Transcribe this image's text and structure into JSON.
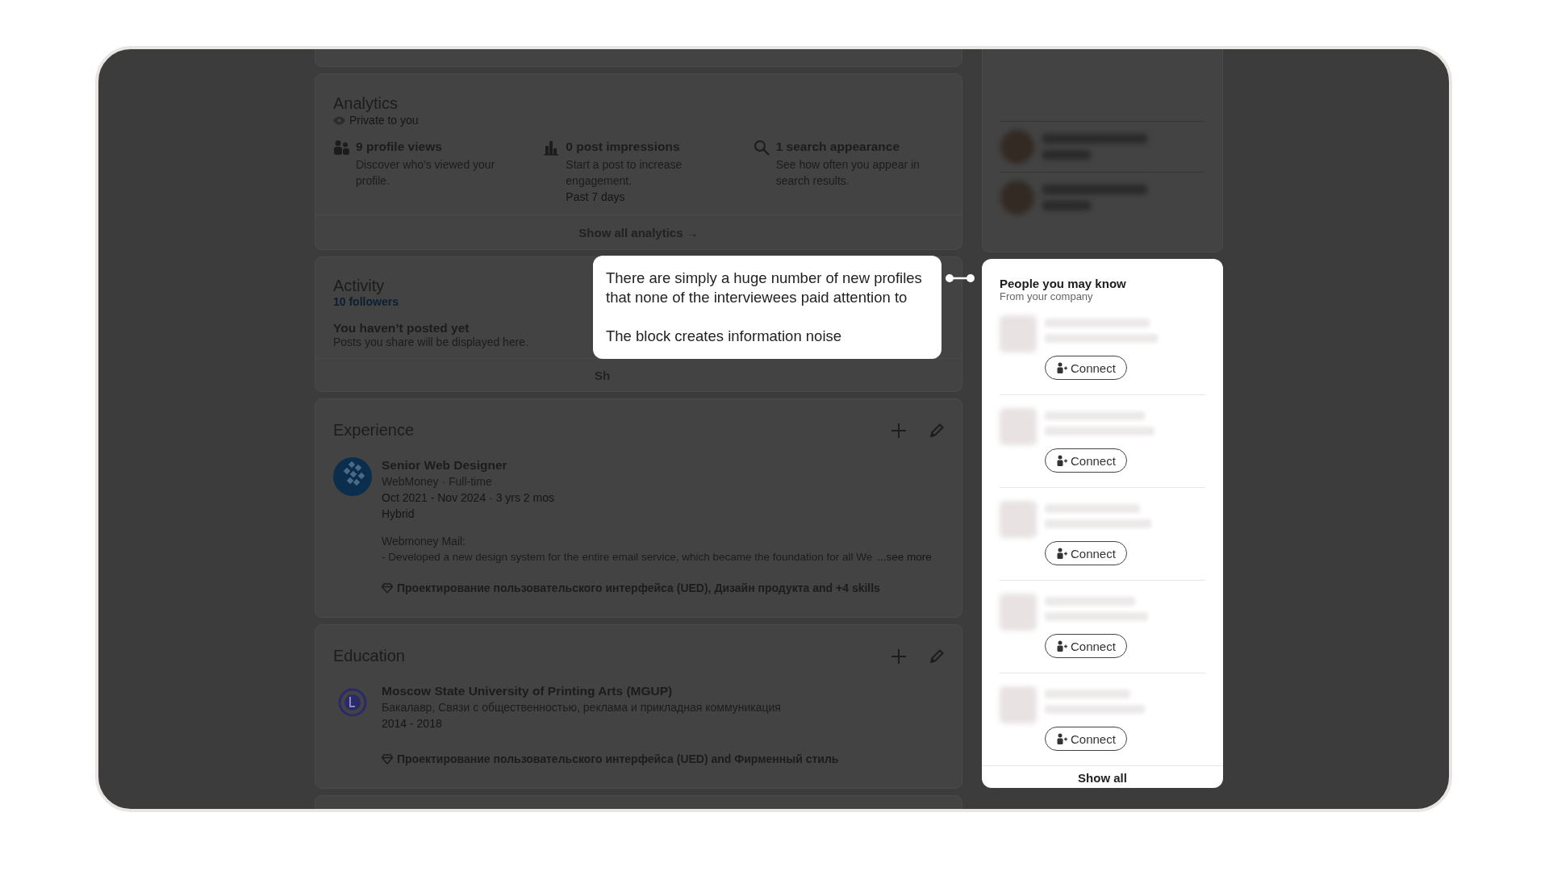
{
  "analytics": {
    "title": "Analytics",
    "privacy": "Private to you",
    "metrics": [
      {
        "kind": "people",
        "title": "9 profile views",
        "description": "Discover who's viewed your profile."
      },
      {
        "kind": "chart",
        "title": "0 post impressions",
        "description": "Start a post to increase engagement.",
        "note": "Past 7 days"
      },
      {
        "kind": "search",
        "title": "1 search appearance",
        "description": "See how often you appear in search results."
      }
    ],
    "footer": "Show all analytics →"
  },
  "activity": {
    "title": "Activity",
    "followers": "10 followers",
    "empty_title": "You haven’t posted yet",
    "empty_text": "Posts you share will be displayed here.",
    "footer": "Sh"
  },
  "experience": {
    "title": "Experience",
    "items": [
      {
        "title": "Senior Web Designer",
        "company": "WebMoney · Full-time",
        "dates": "Oct 2021 - Nov 2024 · 3 yrs 2 mos",
        "location": "Hybrid",
        "description_title": "Webmoney Mail:",
        "description": "- Developed a new design system for the entire email service, which became the foundation for all We",
        "see_more": "...see more",
        "skills": "Проектирование пользовательского интерфейса (UED), Дизайн продукта and +4 skills"
      }
    ]
  },
  "education": {
    "title": "Education",
    "items": [
      {
        "school": "Moscow State University of Printing Arts (MGUP)",
        "degree": "Бакалавр, Связи с общественностью, реклама и прикладная коммуникация",
        "dates": "2014 - 2018",
        "skills": "Проектирование пользовательского интерфейса (UED) and Фирменный стиль"
      }
    ]
  },
  "callout": {
    "paragraphs": [
      "There are simply a huge number of new profiles that none of the interviewees paid attention to",
      "The block creates information noise"
    ]
  },
  "people": {
    "title": "People you may know",
    "subtitle": "From your company",
    "suggestions": [
      {
        "action": "Connect"
      },
      {
        "action": "Connect"
      },
      {
        "action": "Connect"
      },
      {
        "action": "Connect"
      },
      {
        "action": "Connect"
      }
    ],
    "footer": "Show all"
  }
}
